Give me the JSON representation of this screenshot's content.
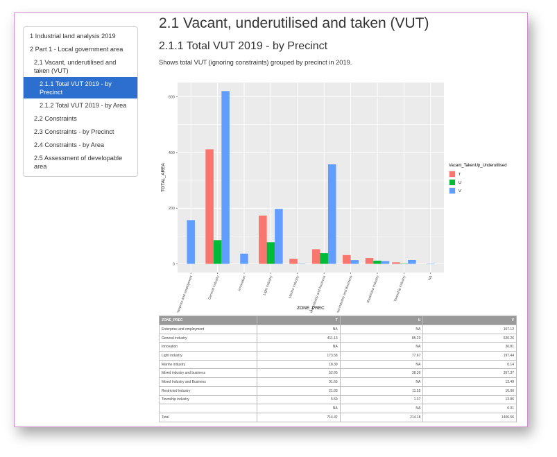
{
  "toc": {
    "items": [
      {
        "label": "1 Industrial land analysis 2019",
        "level": 1,
        "active": false
      },
      {
        "label": "2 Part 1 - Local government area",
        "level": 1,
        "active": false
      },
      {
        "label": "2.1 Vacant, underutilised and taken (VUT)",
        "level": 2,
        "active": false
      },
      {
        "label": "2.1.1 Total VUT 2019 - by Precinct",
        "level": 3,
        "active": true
      },
      {
        "label": "2.1.2 Total VUT 2019 - by Area",
        "level": 3,
        "active": false
      },
      {
        "label": "2.2 Constraints",
        "level": 2,
        "active": false
      },
      {
        "label": "2.3 Constraints - by Precinct",
        "level": 2,
        "active": false
      },
      {
        "label": "2.4 Constraints - by Area",
        "level": 2,
        "active": false
      },
      {
        "label": "2.5 Assessment of developable area",
        "level": 2,
        "active": false
      }
    ]
  },
  "main": {
    "page_title": "2.1 Vacant, underutilised and taken (VUT)",
    "section_title": "2.1.1 Total VUT 2019 - by Precinct",
    "description": "Shows total VUT (ignoring constraints) grouped by precinct in 2019."
  },
  "colors": {
    "T": "#f8766d",
    "U": "#00ba38",
    "V": "#619cff",
    "panel": "#ebebeb",
    "grid": "#ffffff"
  },
  "chart_data": {
    "type": "bar",
    "categories": [
      "Enterprise and employment",
      "General industry",
      "Innovation",
      "Light industry",
      "Marine industry",
      "Mixed industry and business",
      "Mixed Industry and Business",
      "Restricted industry",
      "Township industry",
      "NA"
    ],
    "series": [
      {
        "name": "T",
        "values": [
          null,
          411.13,
          null,
          173.58,
          18.39,
          52.65,
          31.65,
          21.03,
          5.59,
          null
        ]
      },
      {
        "name": "U",
        "values": [
          null,
          85.2,
          null,
          77.67,
          null,
          38.39,
          null,
          11.55,
          1.37,
          null
        ]
      },
      {
        "name": "V",
        "values": [
          157.12,
          620.26,
          36.81,
          197.44,
          0.14,
          357.37,
          13.49,
          10.06,
          13.86,
          0.01
        ]
      }
    ],
    "title": "",
    "xlabel": "ZONE_PREC",
    "ylabel": "TOTAL_AREA",
    "yticks": [
      0,
      200,
      400,
      600
    ],
    "ylim": [
      -31,
      651
    ],
    "legend_title": "Vacant_TakenUp_Underutilised",
    "legend_placement": "right",
    "grid": true
  },
  "table": {
    "headers": [
      "ZONE_PREC",
      "T",
      "U",
      "V"
    ],
    "rows": [
      [
        "Enterprise and employment",
        "NA",
        "NA",
        "157.12"
      ],
      [
        "General industry",
        "411.13",
        "85.20",
        "620.26"
      ],
      [
        "Innovation",
        "NA",
        "NA",
        "36.81"
      ],
      [
        "Light industry",
        "173.58",
        "77.67",
        "197.44"
      ],
      [
        "Marine industry",
        "18.39",
        "NA",
        "0.14"
      ],
      [
        "Mixed industry and business",
        "52.65",
        "38.39",
        "357.37"
      ],
      [
        "Mixed Industry and Business",
        "31.65",
        "NA",
        "13.49"
      ],
      [
        "Restricted industry",
        "21.03",
        "11.55",
        "10.06"
      ],
      [
        "Township industry",
        "5.59",
        "1.37",
        "13.86"
      ],
      [
        "",
        "NA",
        "NA",
        "0.01"
      ],
      [
        "Total",
        "714.42",
        "214.18",
        "1406.56"
      ]
    ]
  }
}
